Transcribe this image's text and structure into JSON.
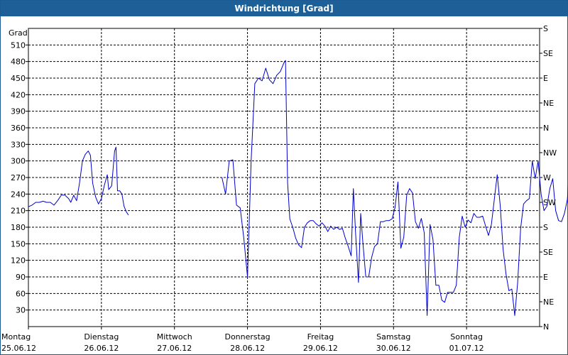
{
  "window": {
    "title": "Windrichtung [Grad]"
  },
  "chart_data": {
    "type": "line",
    "title": "Windrichtung [Grad]",
    "ylabel": "Grad",
    "ylim": [
      0,
      540
    ],
    "yticks": [
      30,
      60,
      90,
      120,
      150,
      180,
      210,
      240,
      270,
      300,
      330,
      360,
      390,
      420,
      450,
      480,
      510
    ],
    "y2_labels": [
      {
        "value": 0,
        "label": "N"
      },
      {
        "value": 45,
        "label": "NE"
      },
      {
        "value": 90,
        "label": "E"
      },
      {
        "value": 135,
        "label": "SE"
      },
      {
        "value": 180,
        "label": "S"
      },
      {
        "value": 225,
        "label": "SW"
      },
      {
        "value": 270,
        "label": "W"
      },
      {
        "value": 315,
        "label": "NW"
      },
      {
        "value": 360,
        "label": "N"
      },
      {
        "value": 405,
        "label": "NE"
      },
      {
        "value": 450,
        "label": "E"
      },
      {
        "value": 495,
        "label": "SE"
      },
      {
        "value": 540,
        "label": "S"
      }
    ],
    "x_days": [
      {
        "day": "Montag",
        "date": "25.06.12"
      },
      {
        "day": "Dienstag",
        "date": "26.06.12"
      },
      {
        "day": "Mittwoch",
        "date": "27.06.12"
      },
      {
        "day": "Donnerstag",
        "date": "28.06.12"
      },
      {
        "day": "Freitag",
        "date": "29.06.12"
      },
      {
        "day": "Samstag",
        "date": "30.06.12"
      },
      {
        "day": "Sonntag",
        "date": "01.07.12"
      }
    ],
    "xlim": [
      0,
      7
    ],
    "grid": true,
    "line_color": "#0000cc",
    "series": [
      {
        "segments": [
          [
            [
              0.0,
              217
            ],
            [
              0.05,
              220
            ],
            [
              0.1,
              225
            ],
            [
              0.15,
              225
            ],
            [
              0.2,
              227
            ],
            [
              0.25,
              225
            ],
            [
              0.3,
              225
            ],
            [
              0.35,
              220
            ],
            [
              0.4,
              228
            ],
            [
              0.45,
              238
            ],
            [
              0.5,
              238
            ],
            [
              0.55,
              232
            ],
            [
              0.58,
              225
            ],
            [
              0.62,
              238
            ],
            [
              0.66,
              228
            ],
            [
              0.7,
              260
            ],
            [
              0.74,
              300
            ],
            [
              0.78,
              312
            ],
            [
              0.82,
              318
            ],
            [
              0.85,
              310
            ],
            [
              0.88,
              260
            ],
            [
              0.92,
              235
            ],
            [
              0.96,
              222
            ],
            [
              1.0,
              232
            ],
            [
              1.04,
              256
            ],
            [
              1.08,
              275
            ],
            [
              1.1,
              248
            ],
            [
              1.14,
              255
            ],
            [
              1.18,
              318
            ],
            [
              1.2,
              325
            ],
            [
              1.22,
              246
            ],
            [
              1.25,
              246
            ],
            [
              1.28,
              240
            ],
            [
              1.31,
              218
            ],
            [
              1.34,
              208
            ],
            [
              1.37,
              202
            ]
          ],
          [
            [
              2.65,
              270
            ],
            [
              2.7,
              240
            ],
            [
              2.75,
              300
            ],
            [
              2.8,
              302
            ],
            [
              2.85,
              220
            ],
            [
              2.9,
              215
            ],
            [
              2.95,
              160
            ],
            [
              3.0,
              90
            ],
            [
              3.05,
              300
            ],
            [
              3.1,
              440
            ],
            [
              3.15,
              450
            ],
            [
              3.2,
              445
            ],
            [
              3.25,
              468
            ],
            [
              3.3,
              447
            ],
            [
              3.35,
              440
            ],
            [
              3.4,
              455
            ],
            [
              3.45,
              462
            ],
            [
              3.5,
              478
            ],
            [
              3.52,
              482
            ],
            [
              3.55,
              260
            ],
            [
              3.58,
              195
            ],
            [
              3.62,
              180
            ],
            [
              3.66,
              160
            ],
            [
              3.7,
              148
            ],
            [
              3.74,
              143
            ],
            [
              3.78,
              180
            ],
            [
              3.82,
              188
            ],
            [
              3.86,
              192
            ],
            [
              3.9,
              192
            ],
            [
              3.94,
              186
            ],
            [
              3.98,
              182
            ],
            [
              4.02,
              188
            ],
            [
              4.06,
              182
            ],
            [
              4.1,
              172
            ],
            [
              4.14,
              182
            ],
            [
              4.18,
              176
            ],
            [
              4.22,
              180
            ],
            [
              4.26,
              176
            ],
            [
              4.3,
              178
            ],
            [
              4.34,
              160
            ],
            [
              4.38,
              145
            ],
            [
              4.42,
              128
            ],
            [
              4.45,
              250
            ],
            [
              4.48,
              170
            ],
            [
              4.52,
              80
            ],
            [
              4.55,
              205
            ],
            [
              4.58,
              152
            ],
            [
              4.62,
              90
            ],
            [
              4.66,
              90
            ],
            [
              4.7,
              125
            ],
            [
              4.74,
              145
            ],
            [
              4.78,
              150
            ],
            [
              4.82,
              190
            ],
            [
              4.86,
              190
            ],
            [
              4.9,
              192
            ],
            [
              4.94,
              192
            ],
            [
              4.98,
              195
            ],
            [
              5.02,
              215
            ],
            [
              5.06,
              262
            ],
            [
              5.1,
              142
            ],
            [
              5.14,
              162
            ],
            [
              5.18,
              238
            ],
            [
              5.22,
              250
            ],
            [
              5.26,
              242
            ],
            [
              5.3,
              190
            ],
            [
              5.34,
              178
            ],
            [
              5.38,
              196
            ],
            [
              5.42,
              170
            ],
            [
              5.46,
              20
            ],
            [
              5.5,
              185
            ],
            [
              5.54,
              158
            ],
            [
              5.58,
              75
            ],
            [
              5.62,
              75
            ],
            [
              5.66,
              48
            ],
            [
              5.7,
              44
            ],
            [
              5.74,
              62
            ],
            [
              5.78,
              62
            ],
            [
              5.82,
              62
            ],
            [
              5.86,
              75
            ],
            [
              5.9,
              162
            ],
            [
              5.94,
              200
            ],
            [
              5.98,
              180
            ],
            [
              6.02,
              193
            ],
            [
              6.06,
              188
            ],
            [
              6.1,
              205
            ],
            [
              6.14,
              198
            ],
            [
              6.18,
              198
            ],
            [
              6.22,
              200
            ],
            [
              6.26,
              182
            ],
            [
              6.3,
              165
            ],
            [
              6.34,
              185
            ],
            [
              6.38,
              230
            ],
            [
              6.42,
              275
            ],
            [
              6.46,
              220
            ],
            [
              6.5,
              140
            ],
            [
              6.54,
              95
            ],
            [
              6.58,
              65
            ],
            [
              6.62,
              68
            ],
            [
              6.66,
              20
            ],
            [
              6.7,
              80
            ],
            [
              6.74,
              178
            ],
            [
              6.78,
              222
            ],
            [
              6.82,
              228
            ],
            [
              6.86,
              232
            ],
            [
              6.9,
              300
            ],
            [
              6.94,
              268
            ],
            [
              6.98,
              300
            ],
            [
              7.02,
              240
            ],
            [
              7.06,
              210
            ],
            [
              7.1,
              218
            ],
            [
              7.14,
              250
            ],
            [
              7.18,
              268
            ],
            [
              7.22,
              210
            ],
            [
              7.26,
              192
            ],
            [
              7.3,
              190
            ],
            [
              7.34,
              205
            ],
            [
              7.38,
              230
            ],
            [
              7.42,
              310
            ],
            [
              7.46,
              310
            ],
            [
              7.5,
              228
            ],
            [
              7.52,
              272
            ],
            [
              7.56,
              340
            ],
            [
              7.6,
              388
            ]
          ]
        ]
      }
    ]
  }
}
